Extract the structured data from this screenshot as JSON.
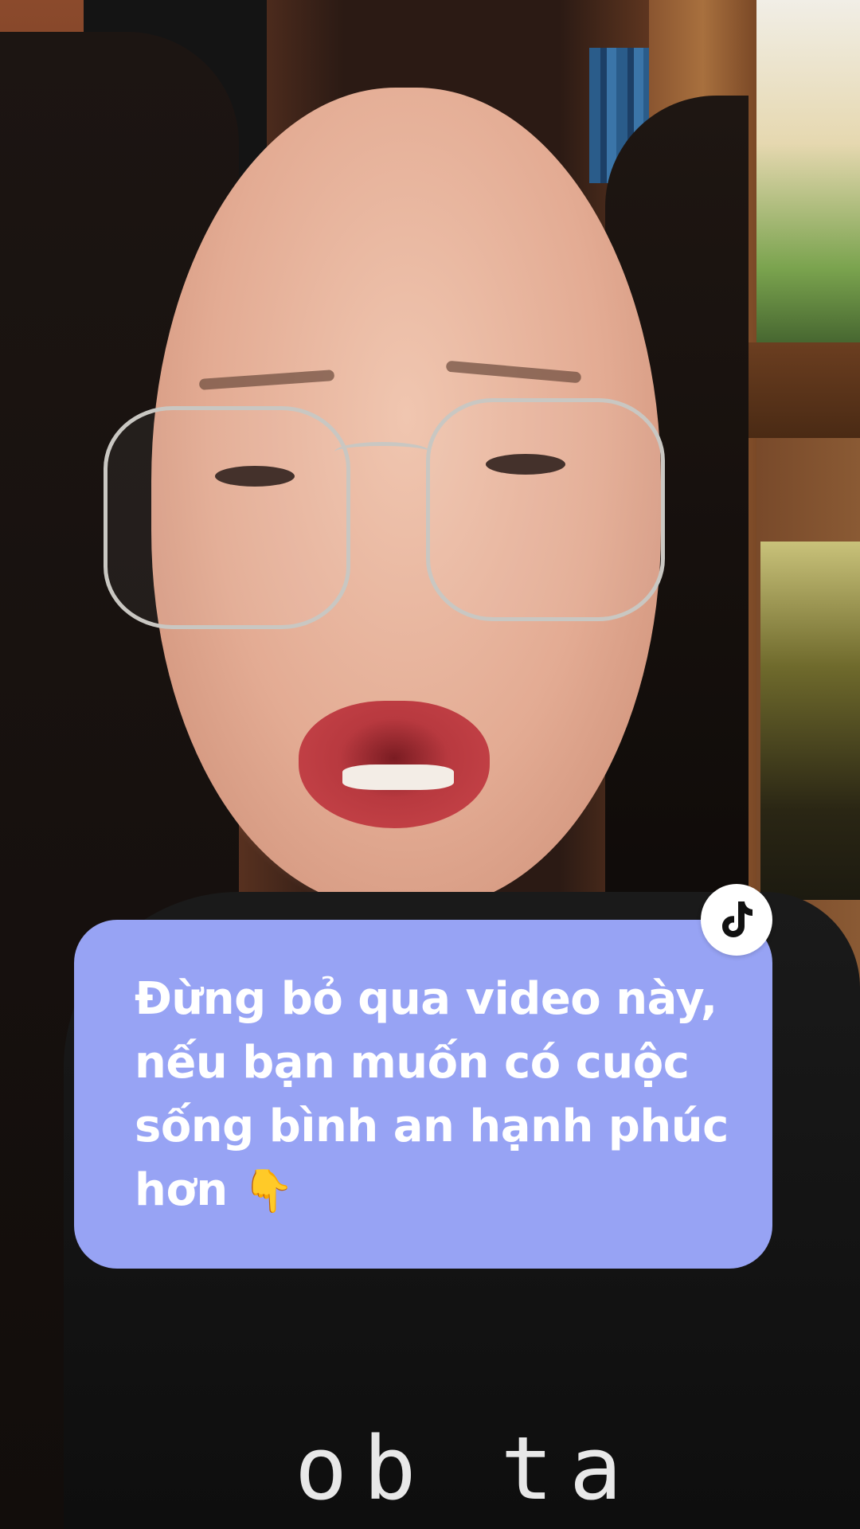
{
  "caption": {
    "lines": [
      "Đừng bỏ qua video này,",
      "nếu bạn muốn có cuộc",
      "sống bình an hạnh phúc",
      "hơn"
    ],
    "emoji": "👇",
    "card_color": "#97a3f4",
    "text_color": "#ffffff"
  },
  "badge": {
    "icon": "tiktok-logo-icon"
  },
  "background": {
    "shirt_text": "ob ta"
  }
}
